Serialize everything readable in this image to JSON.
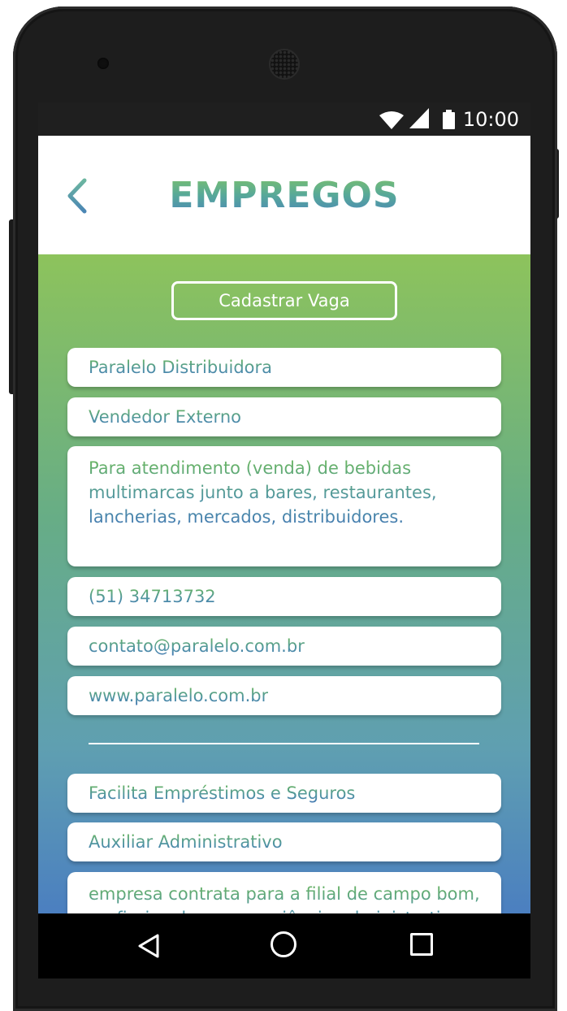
{
  "status_bar": {
    "time": "10:00",
    "icons": [
      "wifi-icon",
      "signal-icon",
      "battery-icon"
    ]
  },
  "app_bar": {
    "title": "EMPREGOS",
    "back_icon": "chevron-left-icon"
  },
  "actions": {
    "register_job_label": "Cadastrar Vaga"
  },
  "jobs": [
    {
      "company": "Paralelo Distribuidora",
      "position": "Vendedor Externo",
      "description": "Para atendimento (venda) de bebidas multimarcas junto a bares, restaurantes, lancherias, mercados, distribuidores.",
      "phone": "(51) 34713732",
      "email": "contato@paralelo.com.br",
      "website": "www.paralelo.com.br"
    },
    {
      "company": "Facilita Empréstimos e Seguros",
      "position": "Auxiliar Administrativo",
      "description": "empresa contrata para a filial de campo bom, profissional com experiência administrativa e"
    }
  ],
  "nav_bar": {
    "icons": [
      "triangle-back-icon",
      "circle-home-icon",
      "square-recents-icon"
    ]
  },
  "colors": {
    "gradient_top": "#8dc35c",
    "gradient_bottom": "#4b7fc0",
    "text_green": "#6cb85c",
    "text_blue": "#4378b3"
  }
}
